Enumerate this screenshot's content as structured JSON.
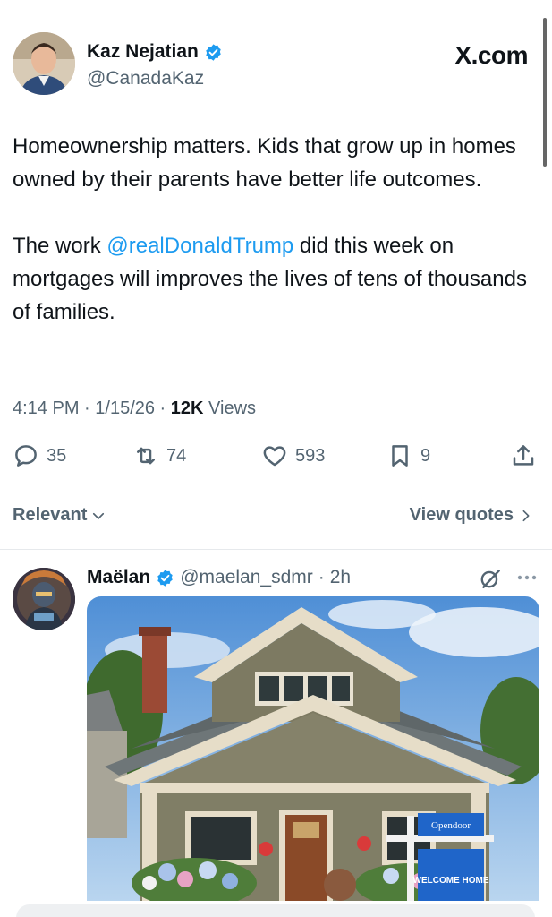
{
  "author": {
    "name": "Kaz Nejatian",
    "handle": "@CanadaKaz",
    "verified": true
  },
  "site_label": "X.com",
  "tweet": {
    "paragraph1": "Homeownership matters. Kids that grow up in homes owned by their parents have better life outcomes.",
    "paragraph2_before": "The work ",
    "paragraph2_mention": "@realDonaldTrump",
    "paragraph2_after": " did this week on mortgages will improves the lives of tens of thousands of families."
  },
  "meta": {
    "time": "4:14 PM",
    "date": "1/15/26",
    "views_count": "12K",
    "views_label": "Views"
  },
  "actions": {
    "replies": "35",
    "reposts": "74",
    "likes": "593",
    "bookmarks": "9"
  },
  "filters": {
    "sort_label": "Relevant",
    "view_quotes_label": "View quotes"
  },
  "reply": {
    "name": "Maëlan",
    "handle": "@maelan_sdmr",
    "time": "2h",
    "image_sign_top": "Opendoor",
    "image_sign_bottom": "WELCOME HOME"
  },
  "colors": {
    "accent": "#1d9bf0",
    "text": "#0f1419",
    "muted": "#536471"
  }
}
